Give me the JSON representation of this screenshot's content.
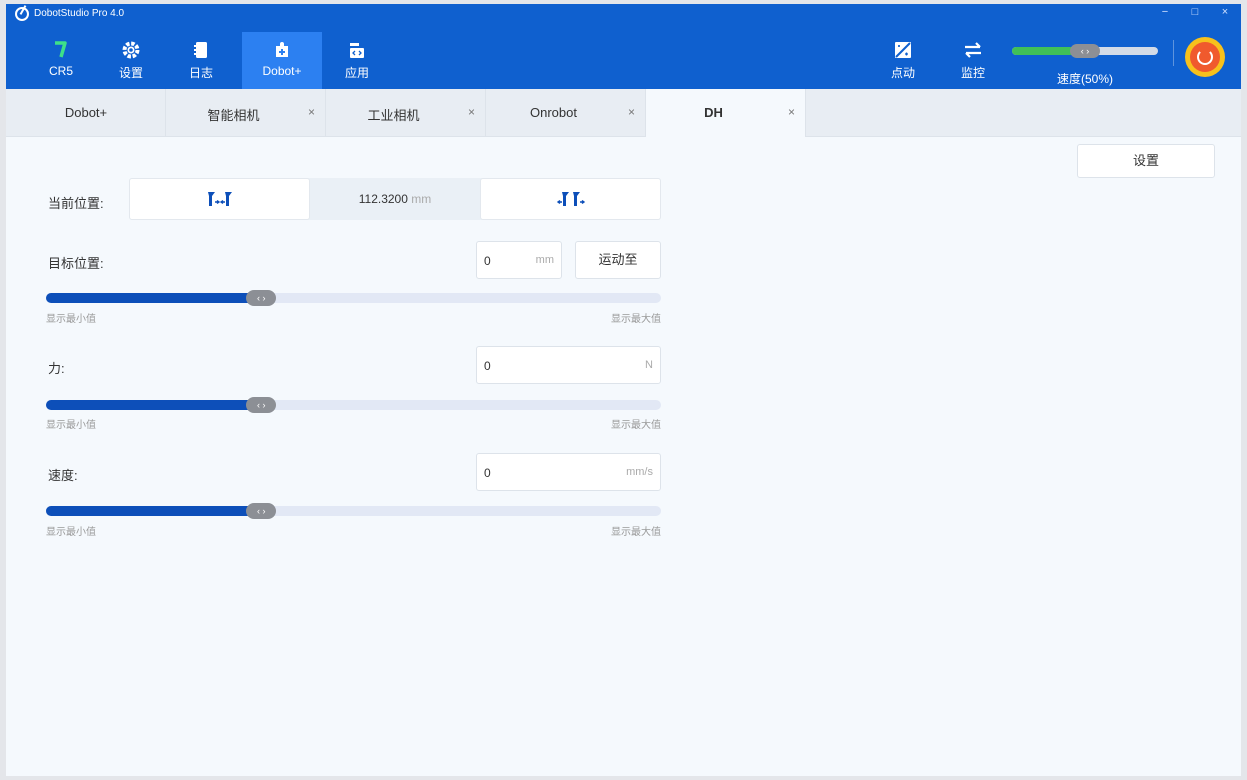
{
  "window": {
    "title": "DobotStudio Pro 4.0",
    "controls": [
      "−",
      "□",
      "×"
    ]
  },
  "nav": [
    {
      "label": "CR5",
      "icon": "robot-arm-icon"
    },
    {
      "label": "设置",
      "icon": "gear-icon"
    },
    {
      "label": "日志",
      "icon": "log-book-icon"
    },
    {
      "label": "Dobot+",
      "icon": "puzzle-plus-icon",
      "active": true
    },
    {
      "label": "应用",
      "icon": "code-app-icon"
    }
  ],
  "tools": [
    {
      "label": "点动",
      "icon": "jog-icon"
    },
    {
      "label": "监控",
      "icon": "monitor-arrows-icon"
    }
  ],
  "speed": {
    "label": "速度(50%)",
    "value_percent": 50,
    "thumb": "‹ ›"
  },
  "tabs": [
    {
      "label": "Dobot+",
      "closable": false
    },
    {
      "label": "智能相机",
      "closable": true
    },
    {
      "label": "工业相机",
      "closable": true
    },
    {
      "label": "Onrobot",
      "closable": true
    },
    {
      "label": "DH",
      "closable": true,
      "active": true
    }
  ],
  "tab_close": "×",
  "settings_label": "设置",
  "current_position": {
    "label": "当前位置:",
    "value": "112.3200",
    "unit": "mm"
  },
  "target_position": {
    "label": "目标位置:",
    "value": "0",
    "unit": "mm",
    "button": "运动至",
    "slider_percent": 35
  },
  "force": {
    "label": "力:",
    "value": "0",
    "unit": "N",
    "slider_percent": 35
  },
  "speed_field": {
    "label": "速度:",
    "value": "0",
    "unit": "mm/s",
    "slider_percent": 35
  },
  "slider_min_label": "显示最小值",
  "slider_max_label": "显示最大值",
  "slider_thumb": "‹ ›",
  "colors": {
    "topbar": "#0f60cf",
    "active_nav": "#2c80f1",
    "slider_fill": "#0d4fb9",
    "speed_fill": "#40c057",
    "estop": "#f05a2d"
  }
}
